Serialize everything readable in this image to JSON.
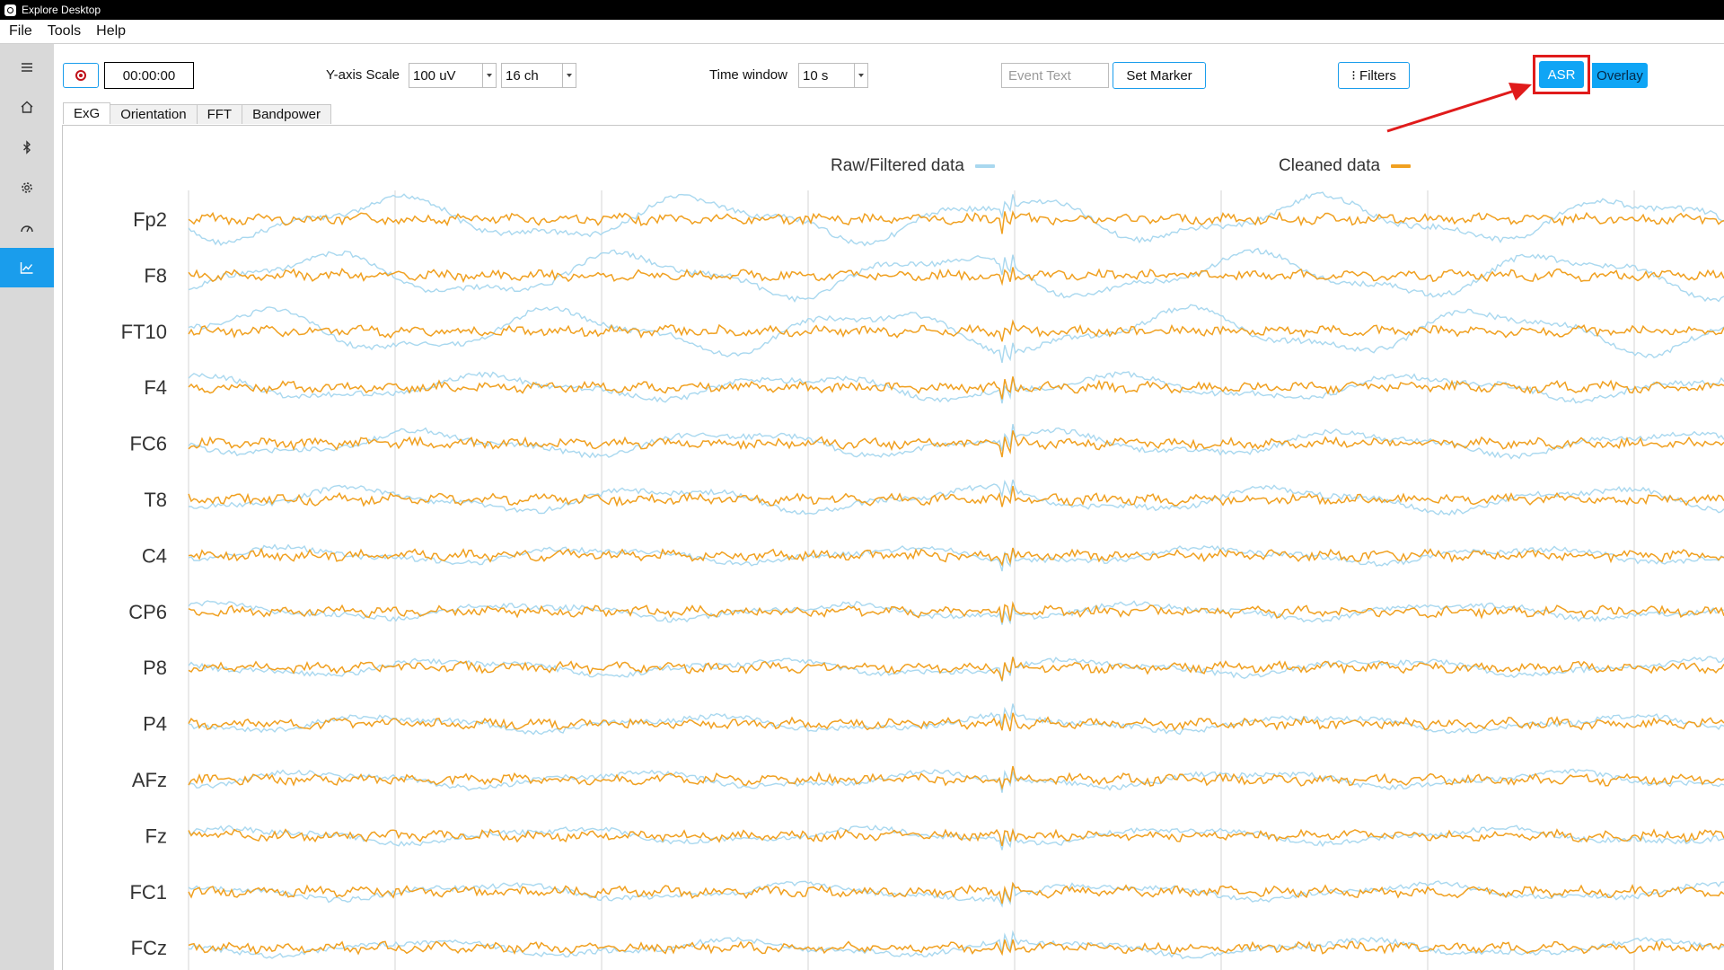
{
  "window": {
    "title": "Explore Desktop"
  },
  "menu": [
    "File",
    "Tools",
    "Help"
  ],
  "sidebar": {
    "items": [
      {
        "icon": "hamburger-menu-icon"
      },
      {
        "icon": "home-icon"
      },
      {
        "icon": "bluetooth-icon"
      },
      {
        "icon": "gear-icon"
      },
      {
        "icon": "gauge-icon"
      },
      {
        "icon": "chart-line-icon",
        "active": true
      }
    ],
    "active_color": "#1a9dec"
  },
  "toolbar": {
    "timer": "00:00:00",
    "yaxis_label": "Y-axis Scale",
    "yaxis_value": "100 uV",
    "channels_value": "16 ch",
    "time_window_label": "Time window",
    "time_window_value": "10 s",
    "event_placeholder": "Event Text",
    "set_marker_label": "Set Marker",
    "filters_label": "⁝ Filters",
    "asr_label": "ASR",
    "overlay_label": "Overlay"
  },
  "tabs": [
    {
      "label": "ExG",
      "active": true
    },
    {
      "label": "Orientation"
    },
    {
      "label": "FFT"
    },
    {
      "label": "Bandpower"
    }
  ],
  "legend": [
    {
      "label": "Raw/Filtered data",
      "color": "#a9d8ef"
    },
    {
      "label": "Cleaned data",
      "color": "#f0a020"
    }
  ],
  "chart_data": {
    "type": "line",
    "channels": [
      "Fp2",
      "F8",
      "FT10",
      "F4",
      "FC6",
      "T8",
      "C4",
      "CP6",
      "P8",
      "P4",
      "AFz",
      "Fz",
      "FC1",
      "FCz"
    ],
    "time_window_s": 10,
    "series": [
      {
        "name": "Raw/Filtered data",
        "color": "#a9d8ef"
      },
      {
        "name": "Cleaned data",
        "color": "#f0a020"
      }
    ],
    "grid": "vertical",
    "legend_position": "top"
  }
}
